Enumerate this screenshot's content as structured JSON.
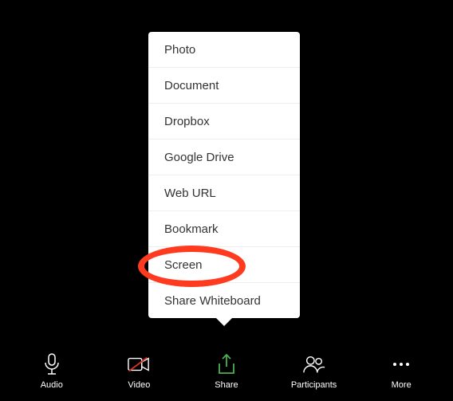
{
  "share_menu": {
    "items": [
      {
        "label": "Photo"
      },
      {
        "label": "Document"
      },
      {
        "label": "Dropbox"
      },
      {
        "label": "Google Drive"
      },
      {
        "label": "Web URL"
      },
      {
        "label": "Bookmark"
      },
      {
        "label": "Screen"
      },
      {
        "label": "Share Whiteboard"
      }
    ]
  },
  "toolbar": {
    "audio": {
      "label": "Audio"
    },
    "video": {
      "label": "Video"
    },
    "share": {
      "label": "Share"
    },
    "participants": {
      "label": "Participants"
    },
    "more": {
      "label": "More"
    }
  },
  "annotation": {
    "highlighted_item": "Screen",
    "highlight_color": "#ff3b1f"
  }
}
